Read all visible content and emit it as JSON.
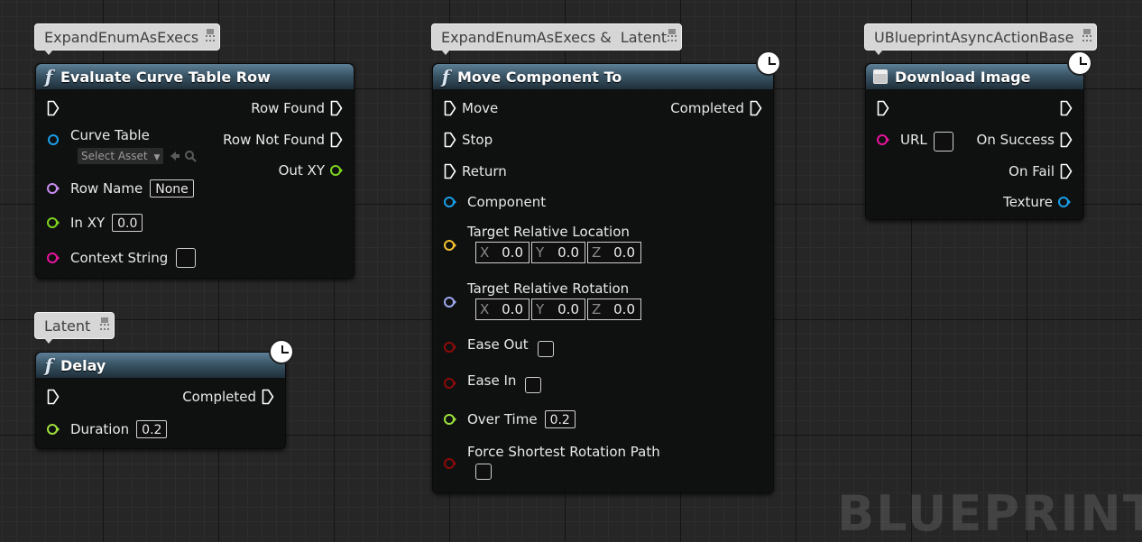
{
  "comments": {
    "evaluate": "ExpandEnumAsExecs",
    "delay": "Latent",
    "move": "ExpandEnumAsExecs &  Latent",
    "download": "UBlueprintAsyncActionBase"
  },
  "evaluate_node": {
    "title": "Evaluate Curve Table Row",
    "icon": "function-icon",
    "pins": {
      "row_found": "Row Found",
      "row_not_found": "Row Not Found",
      "out_xy": "Out XY",
      "curve_table": "Curve Table",
      "select_asset": "Select Asset",
      "row_name": "Row Name",
      "row_name_value": "None",
      "in_xy": "In XY",
      "in_xy_value": "0.0",
      "context_string": "Context String"
    }
  },
  "delay_node": {
    "title": "Delay",
    "icon": "function-icon",
    "pins": {
      "completed": "Completed",
      "duration": "Duration",
      "duration_value": "0.2"
    }
  },
  "move_node": {
    "title": "Move Component To",
    "icon": "function-icon",
    "pins": {
      "move": "Move",
      "stop": "Stop",
      "return": "Return",
      "completed": "Completed",
      "component": "Component",
      "target_location": "Target Relative Location",
      "target_rotation": "Target Relative Rotation",
      "ease_out": "Ease Out",
      "ease_in": "Ease In",
      "over_time": "Over Time",
      "over_time_value": "0.2",
      "force_shortest": "Force Shortest Rotation Path"
    },
    "location": {
      "x_label": "X",
      "x": "0.0",
      "y_label": "Y",
      "y": "0.0",
      "z_label": "Z",
      "z": "0.0"
    },
    "rotation": {
      "x_label": "X",
      "x": "0.0",
      "y_label": "Y",
      "y": "0.0",
      "z_label": "Z",
      "z": "0.0"
    }
  },
  "download_node": {
    "title": "Download Image",
    "icon": "async-action-icon",
    "pins": {
      "url": "URL",
      "on_success": "On Success",
      "on_fail": "On Fail",
      "texture": "Texture"
    }
  },
  "watermark": "BLUEPRINT",
  "colors": {
    "exec": "#ffffff",
    "object": "#1a9ee8",
    "name": "#c88cf0",
    "vector2d": "#7ed321",
    "float": "#9fe03d",
    "string": "#e6149b",
    "vector": "#f2c230",
    "rotator": "#9ea8f0",
    "bool": "#8c0a0a"
  }
}
